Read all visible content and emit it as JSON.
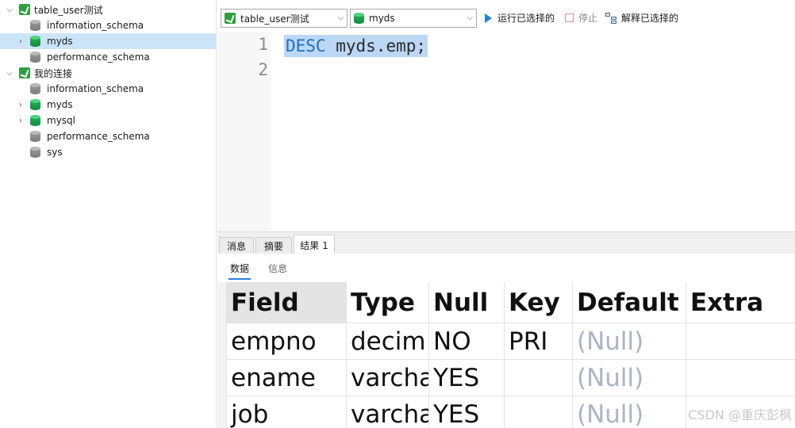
{
  "tree": {
    "connections": [
      {
        "label": "table_user测试",
        "databases": [
          "information_schema",
          "myds",
          "performance_schema"
        ]
      },
      {
        "label": "我的连接",
        "databases": [
          "information_schema",
          "myds",
          "mysql",
          "performance_schema",
          "sys"
        ]
      }
    ],
    "selected": "myds"
  },
  "toolbar": {
    "connection_value": "table_user测试",
    "database_value": "myds",
    "run_selected_label": "运行已选择的",
    "stop_label": "停止",
    "explain_label": "解释已选择的"
  },
  "editor": {
    "line_numbers": [
      "1",
      "2"
    ],
    "keyword": "DESC",
    "identifier": "myds.emp;"
  },
  "result_tabs": [
    "消息",
    "摘要",
    "结果 1"
  ],
  "sub_tabs": [
    "数据",
    "信息"
  ],
  "grid": {
    "columns": [
      "Field",
      "Type",
      "Null",
      "Key",
      "Default",
      "Extra"
    ],
    "rows": [
      [
        "empno",
        "decim",
        "NO",
        "PRI",
        "(Null)",
        ""
      ],
      [
        "ename",
        "varcha",
        "YES",
        "",
        "(Null)",
        ""
      ],
      [
        "job",
        "varcha",
        "YES",
        "",
        "(Null)",
        ""
      ]
    ]
  },
  "watermark": "CSDN @重庆彭枫",
  "colors": {
    "accent": "#2b7fd8",
    "selection": "#bcd7f5",
    "null_text": "#a9b4c4",
    "db_green": "#27b35a"
  }
}
